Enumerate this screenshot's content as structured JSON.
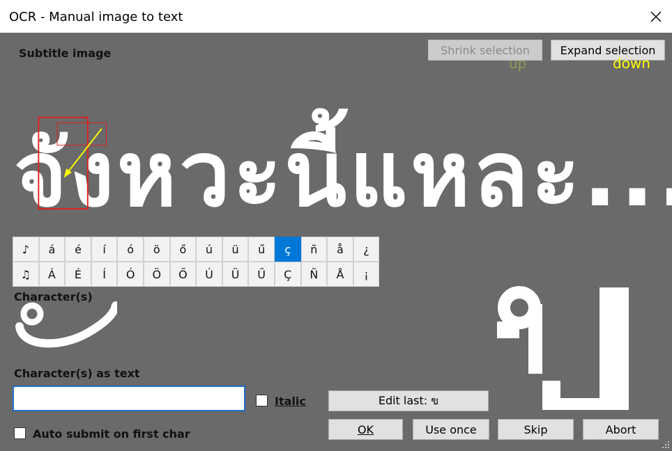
{
  "window": {
    "title": "OCR - Manual image to text"
  },
  "labels": {
    "subtitle_image": "Subtitle image",
    "characters": "Character(s)",
    "characters_as_text": "Character(s) as text"
  },
  "buttons": {
    "shrink": "Shrink selection",
    "expand": "Expand selection",
    "edit_last": "Edit last: ข",
    "ok": "OK",
    "use_once": "Use once",
    "skip": "Skip",
    "abort": "Abort"
  },
  "hints": {
    "up": "up",
    "down": "down",
    "up_color": "#8f9a56",
    "down_color": "#ffff00"
  },
  "subtitle_text": "จังหวะนี้แหละ...",
  "character_preview": "ข",
  "special_chars": {
    "row1": [
      "♪",
      "á",
      "é",
      "í",
      "ó",
      "ö",
      "ő",
      "ú",
      "ü",
      "ű",
      "ç",
      "ñ",
      "å",
      "¿"
    ],
    "row2": [
      "♫",
      "Á",
      "É",
      "Í",
      "Ó",
      "Ö",
      "Ő",
      "Ú",
      "Ü",
      "Ű",
      "Ç",
      "Ñ",
      "Å",
      "¡"
    ],
    "selected": "ç"
  },
  "input": {
    "value": ""
  },
  "checkboxes": {
    "italic": {
      "label": "Italic",
      "checked": false
    },
    "auto_submit": {
      "label": "Auto submit on first char",
      "checked": false
    }
  },
  "colors": {
    "background": "#6a6a6a",
    "selection_box": "#e02020",
    "arrow": "#ffff00",
    "accent": "#0078d7"
  }
}
